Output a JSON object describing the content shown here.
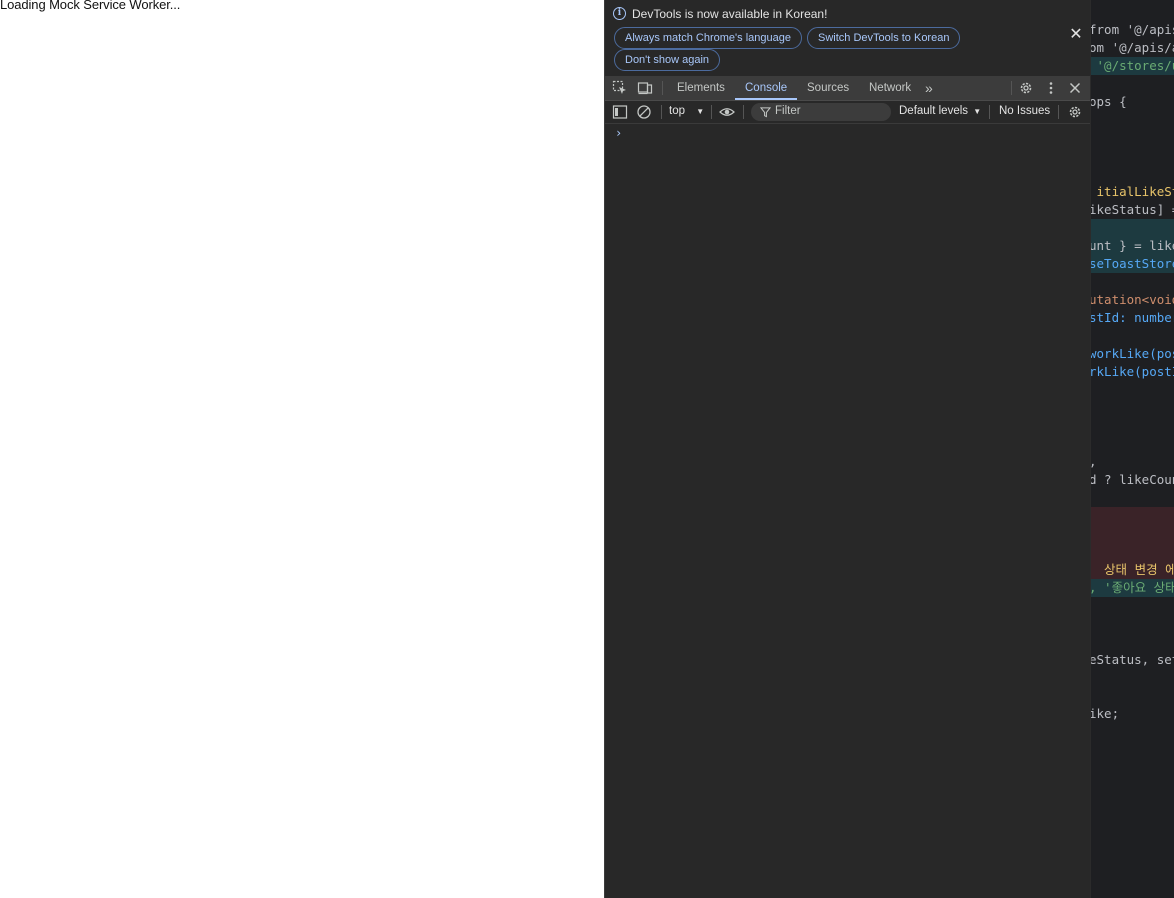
{
  "page": {
    "loading_text": "Loading Mock Service Worker..."
  },
  "devtools": {
    "infobar": {
      "message": "DevTools is now available in Korean!",
      "btn_match": "Always match Chrome's language",
      "btn_switch": "Switch DevTools to Korean",
      "btn_dont_show": "Don't show again",
      "close_icon": "close-icon"
    },
    "tabs": [
      "Elements",
      "Console",
      "Sources",
      "Network"
    ],
    "active_tab": "Console",
    "more_tabs": "»",
    "console": {
      "context": "top",
      "filter_placeholder": "Filter",
      "levels": "Default levels",
      "issues": "No Issues",
      "prompt": "›"
    },
    "colors": {
      "accent": "#a8c7fa",
      "panel_bg": "#282828",
      "toolbar_bg": "#3c3c3c"
    }
  },
  "editor": {
    "lines": [
      {
        "text": "from '@/apis"
      },
      {
        "text": "om '@/apis/a"
      },
      {
        "text": " '@/stores/u"
      },
      {
        "text": ""
      },
      {
        "text": "ops {"
      },
      {
        "text": ""
      },
      {
        "text": ""
      },
      {
        "text": ""
      },
      {
        "text": " itialLikeSta"
      },
      {
        "text": "ikeStatus] ="
      },
      {
        "text": ""
      },
      {
        "text": "unt } = like"
      },
      {
        "text": "seToastStore"
      },
      {
        "text": ""
      },
      {
        "text": "utation<void"
      },
      {
        "text": "stId: number"
      },
      {
        "text": ""
      },
      {
        "text": "workLike(pos"
      },
      {
        "text": "rkLike(postI"
      },
      {
        "text": ""
      },
      {
        "text": ""
      },
      {
        "text": ""
      },
      {
        "text": ","
      },
      {
        "text": "d ? likeCoun"
      },
      {
        "text": ""
      },
      {
        "text": ""
      },
      {
        "text": ""
      },
      {
        "text": ""
      },
      {
        "text": "  상태 변경 에러"
      },
      {
        "text": ", '좋아요 상태가"
      },
      {
        "text": ""
      },
      {
        "text": ""
      },
      {
        "text": ""
      },
      {
        "text": ""
      },
      {
        "text": ""
      },
      {
        "text": "eStatus, set"
      },
      {
        "text": ""
      },
      {
        "text": ""
      },
      {
        "text": "ike;"
      }
    ]
  }
}
